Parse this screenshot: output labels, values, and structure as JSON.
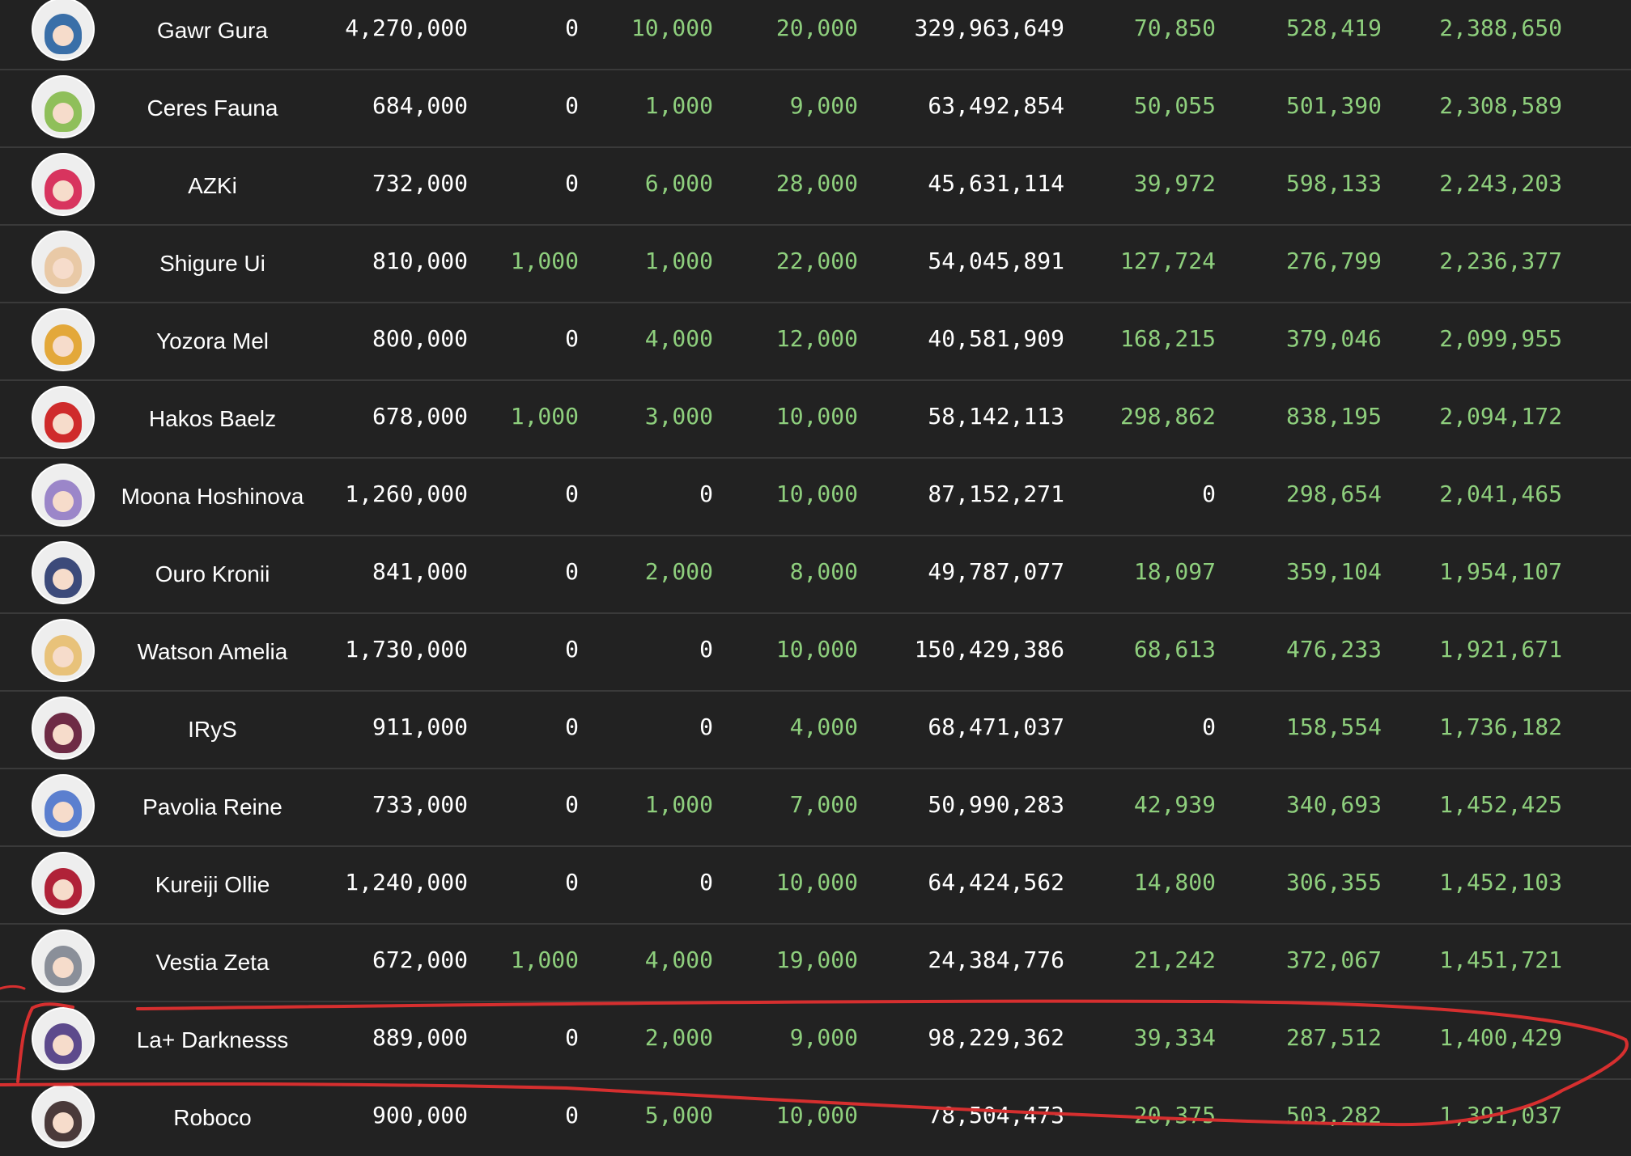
{
  "colors": {
    "background": "#222222",
    "row_divider": "#3a3a3a",
    "name_text": "#ffffff",
    "value_white": "#ffffff",
    "value_green": "#8ecf7d",
    "annotation_red": "#d62f2f"
  },
  "rows": [
    {
      "name": "Gawr Gura",
      "avatar_icon": "gawr-gura-avatar-icon",
      "avatar_color": "#3a6fa8",
      "c1": "4,270,000",
      "c2": "0",
      "c3": "10,000",
      "c4": "20,000",
      "c5": "329,963,649",
      "c6": "70,850",
      "c7": "528,419",
      "c8": "2,388,650",
      "green": [
        false,
        false,
        true,
        true,
        false,
        true,
        true,
        true
      ]
    },
    {
      "name": "Ceres Fauna",
      "avatar_icon": "ceres-fauna-avatar-icon",
      "avatar_color": "#8fbf5a",
      "c1": "684,000",
      "c2": "0",
      "c3": "1,000",
      "c4": "9,000",
      "c5": "63,492,854",
      "c6": "50,055",
      "c7": "501,390",
      "c8": "2,308,589",
      "green": [
        false,
        false,
        true,
        true,
        false,
        true,
        true,
        true
      ]
    },
    {
      "name": "AZKi",
      "avatar_icon": "azki-avatar-icon",
      "avatar_color": "#d8345e",
      "c1": "732,000",
      "c2": "0",
      "c3": "6,000",
      "c4": "28,000",
      "c5": "45,631,114",
      "c6": "39,972",
      "c7": "598,133",
      "c8": "2,243,203",
      "green": [
        false,
        false,
        true,
        true,
        false,
        true,
        true,
        true
      ]
    },
    {
      "name": "Shigure Ui",
      "avatar_icon": "shigure-ui-avatar-icon",
      "avatar_color": "#e9c9a6",
      "c1": "810,000",
      "c2": "1,000",
      "c3": "1,000",
      "c4": "22,000",
      "c5": "54,045,891",
      "c6": "127,724",
      "c7": "276,799",
      "c8": "2,236,377",
      "green": [
        false,
        true,
        true,
        true,
        false,
        true,
        true,
        true
      ]
    },
    {
      "name": "Yozora Mel",
      "avatar_icon": "yozora-mel-avatar-icon",
      "avatar_color": "#e3a83a",
      "c1": "800,000",
      "c2": "0",
      "c3": "4,000",
      "c4": "12,000",
      "c5": "40,581,909",
      "c6": "168,215",
      "c7": "379,046",
      "c8": "2,099,955",
      "green": [
        false,
        false,
        true,
        true,
        false,
        true,
        true,
        true
      ]
    },
    {
      "name": "Hakos Baelz",
      "avatar_icon": "hakos-baelz-avatar-icon",
      "avatar_color": "#cf2b2b",
      "c1": "678,000",
      "c2": "1,000",
      "c3": "3,000",
      "c4": "10,000",
      "c5": "58,142,113",
      "c6": "298,862",
      "c7": "838,195",
      "c8": "2,094,172",
      "green": [
        false,
        true,
        true,
        true,
        false,
        true,
        true,
        true
      ]
    },
    {
      "name": "Moona Hoshinova",
      "avatar_icon": "moona-hoshinova-avatar-icon",
      "avatar_color": "#9b86c9",
      "c1": "1,260,000",
      "c2": "0",
      "c3": "0",
      "c4": "10,000",
      "c5": "87,152,271",
      "c6": "0",
      "c7": "298,654",
      "c8": "2,041,465",
      "green": [
        false,
        false,
        false,
        true,
        false,
        false,
        true,
        true
      ]
    },
    {
      "name": "Ouro Kronii",
      "avatar_icon": "ouro-kronii-avatar-icon",
      "avatar_color": "#3c4a7a",
      "c1": "841,000",
      "c2": "0",
      "c3": "2,000",
      "c4": "8,000",
      "c5": "49,787,077",
      "c6": "18,097",
      "c7": "359,104",
      "c8": "1,954,107",
      "green": [
        false,
        false,
        true,
        true,
        false,
        true,
        true,
        true
      ]
    },
    {
      "name": "Watson Amelia",
      "avatar_icon": "watson-amelia-avatar-icon",
      "avatar_color": "#e8c27a",
      "c1": "1,730,000",
      "c2": "0",
      "c3": "0",
      "c4": "10,000",
      "c5": "150,429,386",
      "c6": "68,613",
      "c7": "476,233",
      "c8": "1,921,671",
      "green": [
        false,
        false,
        false,
        true,
        false,
        true,
        true,
        true
      ]
    },
    {
      "name": "IRyS",
      "avatar_icon": "irys-avatar-icon",
      "avatar_color": "#6e2b45",
      "c1": "911,000",
      "c2": "0",
      "c3": "0",
      "c4": "4,000",
      "c5": "68,471,037",
      "c6": "0",
      "c7": "158,554",
      "c8": "1,736,182",
      "green": [
        false,
        false,
        false,
        true,
        false,
        false,
        true,
        true
      ]
    },
    {
      "name": "Pavolia Reine",
      "avatar_icon": "pavolia-reine-avatar-icon",
      "avatar_color": "#5b7fcf",
      "c1": "733,000",
      "c2": "0",
      "c3": "1,000",
      "c4": "7,000",
      "c5": "50,990,283",
      "c6": "42,939",
      "c7": "340,693",
      "c8": "1,452,425",
      "green": [
        false,
        false,
        true,
        true,
        false,
        true,
        true,
        true
      ]
    },
    {
      "name": "Kureiji Ollie",
      "avatar_icon": "kureiji-ollie-avatar-icon",
      "avatar_color": "#b02238",
      "c1": "1,240,000",
      "c2": "0",
      "c3": "0",
      "c4": "10,000",
      "c5": "64,424,562",
      "c6": "14,800",
      "c7": "306,355",
      "c8": "1,452,103",
      "green": [
        false,
        false,
        false,
        true,
        false,
        true,
        true,
        true
      ]
    },
    {
      "name": "Vestia Zeta",
      "avatar_icon": "vestia-zeta-avatar-icon",
      "avatar_color": "#8a8f99",
      "c1": "672,000",
      "c2": "1,000",
      "c3": "4,000",
      "c4": "19,000",
      "c5": "24,384,776",
      "c6": "21,242",
      "c7": "372,067",
      "c8": "1,451,721",
      "green": [
        false,
        true,
        true,
        true,
        false,
        true,
        true,
        true
      ]
    },
    {
      "name": "La+ Darknesss",
      "avatar_icon": "la-darknesss-avatar-icon",
      "avatar_color": "#5d4a8c",
      "c1": "889,000",
      "c2": "0",
      "c3": "2,000",
      "c4": "9,000",
      "c5": "98,229,362",
      "c6": "39,334",
      "c7": "287,512",
      "c8": "1,400,429",
      "green": [
        false,
        false,
        true,
        true,
        false,
        true,
        true,
        true
      ]
    },
    {
      "name": "Roboco",
      "avatar_icon": "roboco-avatar-icon",
      "avatar_color": "#4a3a3a",
      "c1": "900,000",
      "c2": "0",
      "c3": "5,000",
      "c4": "10,000",
      "c5": "78,504,473",
      "c6": "20,375",
      "c7": "503,282",
      "c8": "1,391,037",
      "green": [
        false,
        false,
        true,
        true,
        false,
        true,
        true,
        true
      ]
    }
  ]
}
